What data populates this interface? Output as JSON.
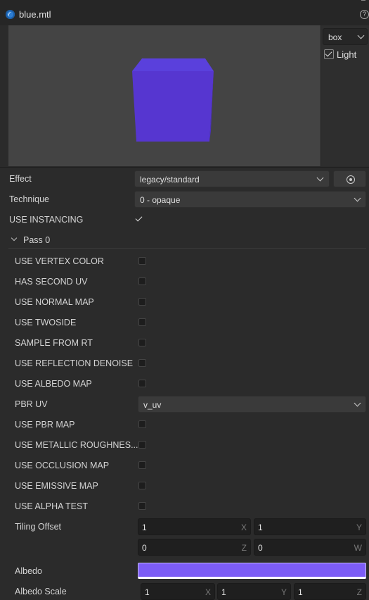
{
  "window": {
    "title": "blue.mtl",
    "title_icon": "cocos-logo-icon",
    "help_icon": "help-icon"
  },
  "preview": {
    "mesh": "box",
    "light_label": "Light",
    "light_checked": true,
    "cube_color": "#5a3fd6",
    "bg_color": "#444444"
  },
  "effect": {
    "label": "Effect",
    "value": "legacy/standard",
    "locate_icon": "locate-icon"
  },
  "technique": {
    "label": "Technique",
    "value": "0 - opaque"
  },
  "use_instancing": {
    "label": "USE INSTANCING",
    "checked": true
  },
  "pass": {
    "label": "Pass 0"
  },
  "options": [
    {
      "label": "USE VERTEX COLOR",
      "checked": false
    },
    {
      "label": "HAS SECOND UV",
      "checked": false
    },
    {
      "label": "USE NORMAL MAP",
      "checked": false
    },
    {
      "label": "USE TWOSIDE",
      "checked": false
    },
    {
      "label": "SAMPLE FROM RT",
      "checked": false
    },
    {
      "label": "USE REFLECTION DENOISE",
      "checked": false
    },
    {
      "label": "USE ALBEDO MAP",
      "checked": false
    }
  ],
  "pbr_uv": {
    "label": "PBR UV",
    "value": "v_uv"
  },
  "options2": [
    {
      "label": "USE PBR MAP",
      "checked": false
    },
    {
      "label": "USE METALLIC ROUGHNES...",
      "checked": false
    },
    {
      "label": "USE OCCLUSION MAP",
      "checked": false
    },
    {
      "label": "USE EMISSIVE MAP",
      "checked": false
    },
    {
      "label": "USE ALPHA TEST",
      "checked": false
    }
  ],
  "tiling_offset": {
    "label": "Tiling Offset",
    "x": "1",
    "y": "1",
    "z": "0",
    "w": "0",
    "axes": {
      "x": "X",
      "y": "Y",
      "z": "Z",
      "w": "W"
    }
  },
  "albedo": {
    "label": "Albedo",
    "color": "#7c5cf6"
  },
  "albedo_scale": {
    "label": "Albedo Scale",
    "x": "1",
    "y": "1",
    "z": "1",
    "axes": {
      "x": "X",
      "y": "Y",
      "z": "Z"
    }
  }
}
